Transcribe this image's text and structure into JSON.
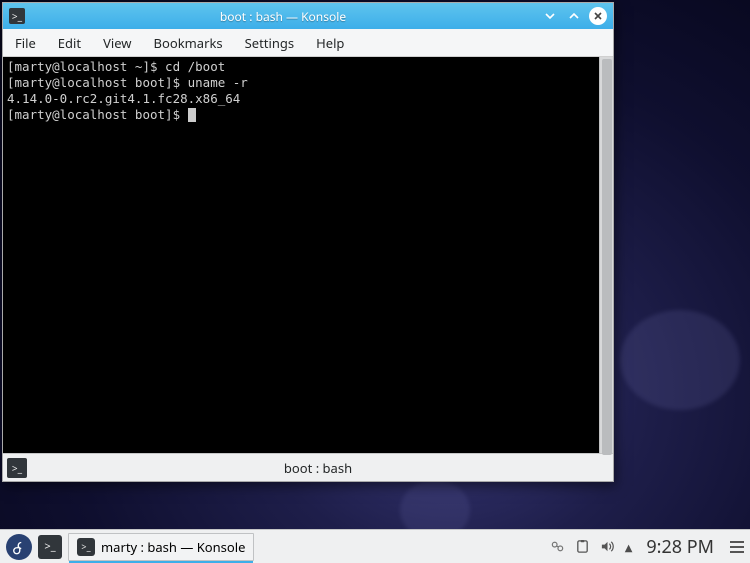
{
  "window": {
    "title": "boot : bash — Konsole",
    "menus": [
      "File",
      "Edit",
      "View",
      "Bookmarks",
      "Settings",
      "Help"
    ],
    "tab_label": "boot : bash"
  },
  "terminal": {
    "lines": [
      "[marty@localhost ~]$ cd /boot",
      "[marty@localhost boot]$ uname -r",
      "4.14.0-0.rc2.git4.1.fc28.x86_64",
      "[marty@localhost boot]$ "
    ]
  },
  "panel": {
    "task_label": "marty : bash — Konsole",
    "clock": "9:28 PM"
  }
}
